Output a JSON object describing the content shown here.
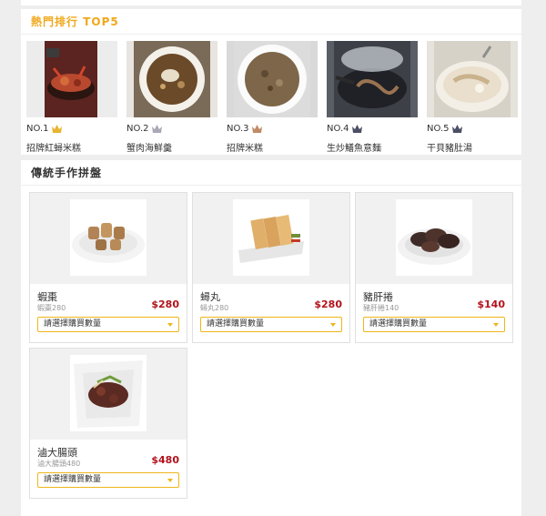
{
  "top5": {
    "title": "熱門排行 TOP5",
    "items": [
      {
        "rank": "NO.1",
        "name": "招牌紅蟳米糕",
        "crown": "gold-crown-icon",
        "crown_color": "#e8b430"
      },
      {
        "rank": "NO.2",
        "name": "蟹肉海鮮羹",
        "crown": "silver-crown-icon",
        "crown_color": "#a9a9b6"
      },
      {
        "rank": "NO.3",
        "name": "招牌米糕",
        "crown": "bronze-crown-icon",
        "crown_color": "#c08a67"
      },
      {
        "rank": "NO.4",
        "name": "生炒鱔魚意麵",
        "crown": "crown-icon",
        "crown_color": "#4b4f63"
      },
      {
        "rank": "NO.5",
        "name": "干貝豬肚湯",
        "crown": "crown-icon",
        "crown_color": "#4b4f63"
      }
    ]
  },
  "platter": {
    "title": "傳統手作拼盤",
    "select_placeholder": "請選擇購買數量",
    "items": [
      {
        "name": "蝦棗",
        "sub": "蝦棗280",
        "price": "$280"
      },
      {
        "name": "蟳丸",
        "sub": "蟳丸280",
        "price": "$280"
      },
      {
        "name": "豬肝捲",
        "sub": "豬肝捲140",
        "price": "$140"
      },
      {
        "name": "滷大腸頭",
        "sub": "滷大腸頭480",
        "price": "$480"
      }
    ]
  },
  "colors": {
    "accent": "#f0a81c",
    "price": "#b3121c",
    "select_border": "#f0b51a"
  }
}
